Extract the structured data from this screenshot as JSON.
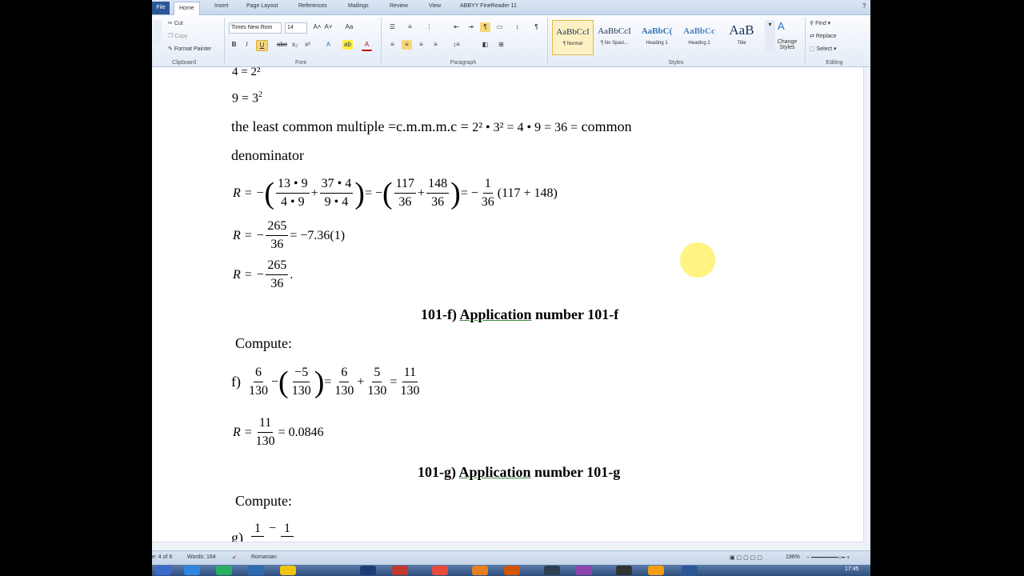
{
  "ribbon": {
    "file_tab": "File",
    "tabs": [
      "Home",
      "Insert",
      "Page Layout",
      "References",
      "Mailings",
      "Review",
      "View",
      "ABBYY FineReader 11"
    ],
    "clipboard": {
      "cut": "Cut",
      "copy": "Copy",
      "format_painter": "Format Painter",
      "label": "Clipboard"
    },
    "font": {
      "name": "Times New Rom",
      "size": "14",
      "label": "Font"
    },
    "paragraph_label": "Paragraph",
    "styles": [
      {
        "sample": "AaBbCcI",
        "name": "¶ Normal"
      },
      {
        "sample": "AaBbCcI",
        "name": "¶ No Spaci..."
      },
      {
        "sample": "AaBbC(",
        "name": "Heading 1"
      },
      {
        "sample": "AaBbCc",
        "name": "Heading 2"
      },
      {
        "sample": "AaB",
        "name": "Title"
      }
    ],
    "change_styles": "Change Styles",
    "styles_label": "Styles",
    "editing": {
      "find": "Find",
      "replace": "Replace",
      "select": "Select",
      "label": "Editing"
    }
  },
  "document": {
    "line_4": "4 = 2²",
    "line_9": "9 = 3",
    "lcm_text": "the least common multiple =c.m.m.m.c =",
    "lcm_expr": "2² • 3² = 4 • 9 = 36 =",
    "lcm_tail": "common",
    "denominator": "denominator",
    "r_eq1": {
      "lhs": "R = −",
      "f1_num": "13 • 9",
      "f1_den": "4 • 9",
      "f2_num": "37 • 4",
      "f2_den": "9 • 4",
      "f3_num": "117",
      "f3_den": "36",
      "f4_num": "148",
      "f4_den": "36",
      "f5_num": "1",
      "f5_den": "36",
      "tail": "(117 + 148)"
    },
    "r_eq2": {
      "lhs": "R = −",
      "num": "265",
      "den": "36",
      "tail": "= −7.36(1)"
    },
    "r_eq3": {
      "lhs": "R = −",
      "num": "265",
      "den": "36",
      "tail": "."
    },
    "heading_f": {
      "prefix": "101-f)",
      "underlined": "Application",
      "rest": "number 101-f"
    },
    "compute_1": "Compute:",
    "eq_f": {
      "label": "f)",
      "a_num": "6",
      "a_den": "130",
      "b_num": "−5",
      "b_den": "130",
      "c_num": "6",
      "c_den": "130",
      "d_num": "5",
      "d_den": "130",
      "e_num": "11",
      "e_den": "130"
    },
    "r_f": {
      "lhs": "R =",
      "num": "11",
      "den": "130",
      "tail": "= 0.0846"
    },
    "heading_g": {
      "prefix": "101-g)",
      "underlined": "Application",
      "rest": "number 101-g"
    },
    "compute_2": "Compute:",
    "eq_g_partial": {
      "label": "g)",
      "a_num": "1",
      "b_num": "1"
    }
  },
  "status": {
    "page": "e: 4 of 6",
    "words": "Words: 164",
    "language": "Romanian",
    "zoom": "196%"
  },
  "taskbar": {
    "time": "17:45"
  }
}
